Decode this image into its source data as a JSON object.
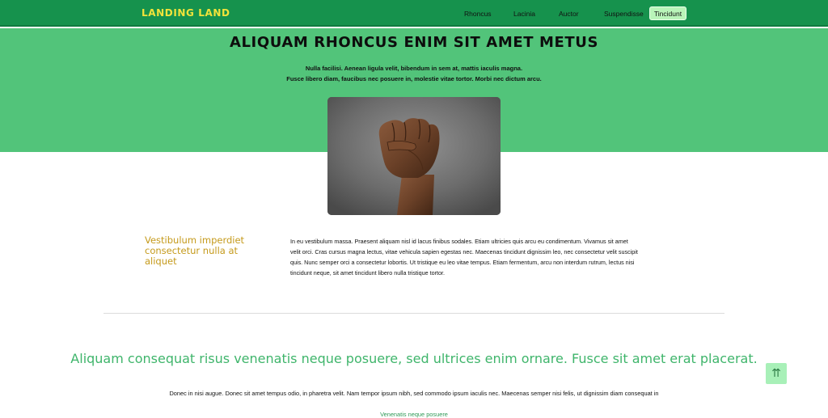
{
  "navbar": {
    "brand": "LANDING LAND",
    "links": [
      "Rhoncus",
      "Lacinia",
      "Auctor",
      "Suspendisse"
    ],
    "active_link": "Tincidunt",
    "colors": {
      "bar": "#16924d",
      "brand": "#f2e33a",
      "active_bg": "#b9f4b9"
    }
  },
  "hero": {
    "title": "ALIQUAM RHONCUS ENIM SIT AMET METUS",
    "subtitle_line1": "Nulla facilisi. Aenean ligula velit, bibendum in sem at, mattis iaculis magna.",
    "subtitle_line2": "Fusce libero diam, faucibus nec posuere in, molestie vitae tortor. Morbi nec dictum arcu.",
    "image_icon": "raised-fist-image",
    "colors": {
      "background": "#52c47a"
    }
  },
  "feature": {
    "heading": "Vestibulum imperdiet consectetur nulla at aliquet",
    "text": "In eu vestibulum massa. Praesent aliquam nisl id lacus finibus sodales. Etiam ultricies quis arcu eu condimentum. Vivamus sit amet velit orci. Cras cursus magna lectus, vitae vehicula sapien egestas nec. Maecenas tincidunt dignissim leo, nec consectetur velit suscipit quis. Nunc semper orci a consectetur lobortis. Ut tristique eu leo vitae tempus. Etiam fermentum, arcu non interdum rutrum, lectus nisi tincidunt neque, sit amet tincidunt libero nulla tristique tortor.",
    "colors": {
      "heading": "#c59a1b"
    }
  },
  "section2": {
    "quote": "Aliquam consequat risus venenatis neque posuere, sed ultrices enim ornare. Fusce sit amet erat placerat.",
    "body": "Donec in nisi augue. Donec sit amet tempus odio, in pharetra velit. Nam tempor ipsum nibh, sed commodo ipsum iaculis nec. Maecenas semper nisi felis, ut dignissim diam consequat in",
    "link": "Venenatis neque posuere",
    "colors": {
      "quote": "#3fb56b"
    }
  },
  "scroll_top": {
    "icon": "up-arrows-icon",
    "glyph": "⇈"
  }
}
